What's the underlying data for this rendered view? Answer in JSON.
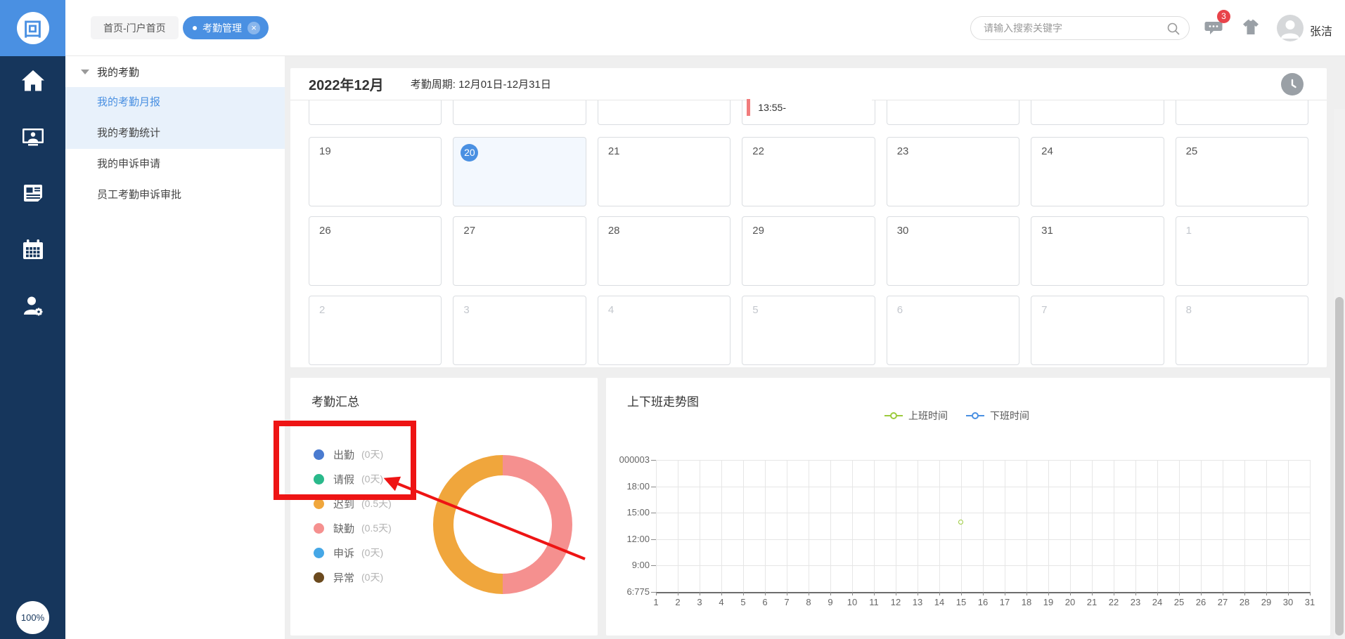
{
  "app_logo_glyph": "回",
  "topbar": {
    "breadcrumb": "首页-门户首页",
    "active_tab": "考勤管理",
    "close_glyph": "×",
    "search_placeholder": "请输入搜索关键字",
    "badge_count": "3",
    "username": "张洁"
  },
  "iconbar": {
    "icons": [
      "home-icon",
      "workspace-icon",
      "news-icon",
      "calendar-icon",
      "user-settings-icon"
    ],
    "zoom_label": "100%"
  },
  "menu": {
    "group_label": "我的考勤",
    "items": [
      {
        "label": "我的考勤月报",
        "active": true,
        "highlighted": true
      },
      {
        "label": "我的考勤统计",
        "active": false,
        "highlighted": true
      },
      {
        "label": "我的申诉申请",
        "active": false,
        "highlighted": false
      },
      {
        "label": "员工考勤申诉审批",
        "active": false,
        "highlighted": false
      }
    ]
  },
  "calendar": {
    "month_title": "2022年12月",
    "period_label": "考勤周期: 12月01日-12月31日",
    "partial_row_event": {
      "col": 3,
      "text": "13:55-"
    },
    "weeks": [
      {
        "days": [
          {
            "d": "19"
          },
          {
            "d": "20",
            "selected": true
          },
          {
            "d": "21"
          },
          {
            "d": "22"
          },
          {
            "d": "23"
          },
          {
            "d": "24"
          },
          {
            "d": "25"
          }
        ]
      },
      {
        "days": [
          {
            "d": "26"
          },
          {
            "d": "27"
          },
          {
            "d": "28"
          },
          {
            "d": "29"
          },
          {
            "d": "30"
          },
          {
            "d": "31"
          },
          {
            "d": "1",
            "muted": true
          }
        ]
      },
      {
        "days": [
          {
            "d": "2",
            "muted": true
          },
          {
            "d": "3",
            "muted": true
          },
          {
            "d": "4",
            "muted": true
          },
          {
            "d": "5",
            "muted": true
          },
          {
            "d": "6",
            "muted": true
          },
          {
            "d": "7",
            "muted": true
          },
          {
            "d": "8",
            "muted": true
          }
        ]
      }
    ]
  },
  "chart_data": [
    {
      "type": "pie",
      "title": "考勤汇总",
      "donut": true,
      "legend": [
        {
          "label": "出勤",
          "count": "(0天)",
          "value_days": 0,
          "color": "#4a7bd0"
        },
        {
          "label": "请假",
          "count": "(0天)",
          "value_days": 0,
          "color": "#2ab98b"
        },
        {
          "label": "迟到",
          "count": "(0.5天)",
          "value_days": 0.5,
          "color": "#f0a63c"
        },
        {
          "label": "缺勤",
          "count": "(0.5天)",
          "value_days": 0.5,
          "color": "#f5908f"
        },
        {
          "label": "申诉",
          "count": "(0天)",
          "value_days": 0,
          "color": "#45a7e6"
        },
        {
          "label": "异常",
          "count": "(0天)",
          "value_days": 0,
          "color": "#6b4a1e"
        }
      ],
      "segments": [
        {
          "label": "迟到",
          "value": 0.5,
          "color": "#f0a63c"
        },
        {
          "label": "缺勤",
          "value": 0.5,
          "color": "#f5908f"
        }
      ]
    },
    {
      "type": "line",
      "title": "上下班走势图",
      "legend_position": "top",
      "y_ticks": [
        {
          "label": "000003",
          "minutes": 1260
        },
        {
          "label": "18:00",
          "minutes": 1080
        },
        {
          "label": "15:00",
          "minutes": 900
        },
        {
          "label": "12:00",
          "minutes": 720
        },
        {
          "label": "9:00",
          "minutes": 540
        },
        {
          "label": "6:775",
          "minutes": 360
        }
      ],
      "x_ticks": [
        "1",
        "2",
        "3",
        "4",
        "5",
        "6",
        "7",
        "8",
        "9",
        "10",
        "11",
        "12",
        "13",
        "14",
        "15",
        "16",
        "17",
        "18",
        "19",
        "20",
        "21",
        "22",
        "23",
        "24",
        "25",
        "26",
        "27",
        "28",
        "29",
        "30",
        "31"
      ],
      "series": [
        {
          "name": "上班时间",
          "color": "#9ccb3d",
          "points": [
            {
              "day": 15,
              "time": "13:55",
              "minutes": 835
            }
          ]
        },
        {
          "name": "下班时间",
          "color": "#4a90e2",
          "points": []
        }
      ]
    }
  ],
  "annotation": {
    "color": "#ee1414"
  }
}
